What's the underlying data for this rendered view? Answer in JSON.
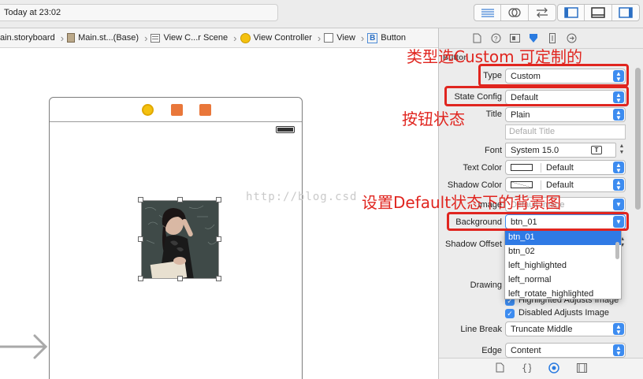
{
  "toolbar": {
    "status": "Today at 23:02",
    "editor_icons": [
      "standard-editor-icon",
      "assistant-editor-icon",
      "version-editor-icon"
    ],
    "view_icons": [
      "navigator-toggle-icon",
      "debug-area-toggle-icon",
      "utilities-toggle-icon"
    ]
  },
  "jumpbar": {
    "crumbs": [
      "ain.storyboard",
      "Main.st...(Base)",
      "View C...r Scene",
      "View Controller",
      "View",
      "Button"
    ]
  },
  "canvas": {
    "watermark": "http://blog.csd"
  },
  "inspector": {
    "section_title": "Button",
    "type": {
      "label": "Type",
      "value": "Custom"
    },
    "state_config": {
      "label": "State Config",
      "value": "Default"
    },
    "title": {
      "label": "Title",
      "value": "Plain"
    },
    "title_field_placeholder": "Default Title",
    "font": {
      "label": "Font",
      "value": "System 15.0",
      "icon": "T"
    },
    "text_color": {
      "label": "Text Color",
      "value": "Default"
    },
    "shadow_color": {
      "label": "Shadow Color",
      "value": "Default"
    },
    "image": {
      "label": "Image",
      "value": "Default Image"
    },
    "background": {
      "label": "Background",
      "value": "btn_01"
    },
    "shadow_offset": {
      "label": "Shadow Offset"
    },
    "drawing": {
      "label": "Drawing"
    },
    "highlighted_adjusts": "Highlighted Adjusts Image",
    "disabled_adjusts": "Disabled Adjusts Image",
    "line_break": {
      "label": "Line Break",
      "value": "Truncate Middle"
    },
    "edge": {
      "label": "Edge",
      "value": "Content"
    }
  },
  "dropdown": {
    "options": [
      "btn_01",
      "btn_02",
      "left_highlighted",
      "left_normal",
      "left_rotate_highlighted"
    ],
    "selected": "btn_01"
  },
  "annotations": {
    "type_note": "类型选Custom 可定制的",
    "state_note": "按钮状态",
    "background_note": "设置Default状态下的背景图"
  },
  "colors": {
    "accent": "#3d8cf0",
    "annotation": "#e0251f"
  }
}
